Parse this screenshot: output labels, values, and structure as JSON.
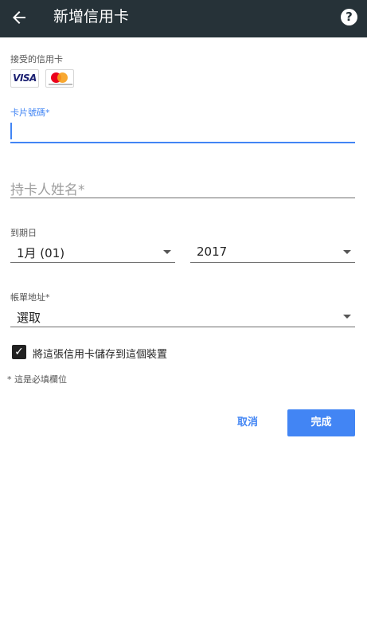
{
  "header": {
    "title": "新增信用卡",
    "back_icon": "arrow-back-icon",
    "help_icon": "help-icon",
    "help_glyph": "?"
  },
  "accepted_cards": {
    "label": "接受的信用卡",
    "visa_text": "VISA",
    "mastercard_icon": "mastercard-logo"
  },
  "card_number": {
    "label": "卡片號碼*",
    "value": ""
  },
  "cardholder_name": {
    "placeholder": "持卡人姓名*",
    "value": ""
  },
  "expiry": {
    "label": "到期日",
    "month": "1月 (01)",
    "year": "2017"
  },
  "billing_address": {
    "label": "帳單地址*",
    "value": "選取"
  },
  "save_card": {
    "label": "將這張信用卡儲存到這個裝置",
    "checked": true,
    "glyph": "✓"
  },
  "required_note": "* 這是必填欄位",
  "buttons": {
    "cancel": "取消",
    "done": "完成"
  },
  "colors": {
    "appbar": "#263238",
    "accent": "#4285f4"
  }
}
